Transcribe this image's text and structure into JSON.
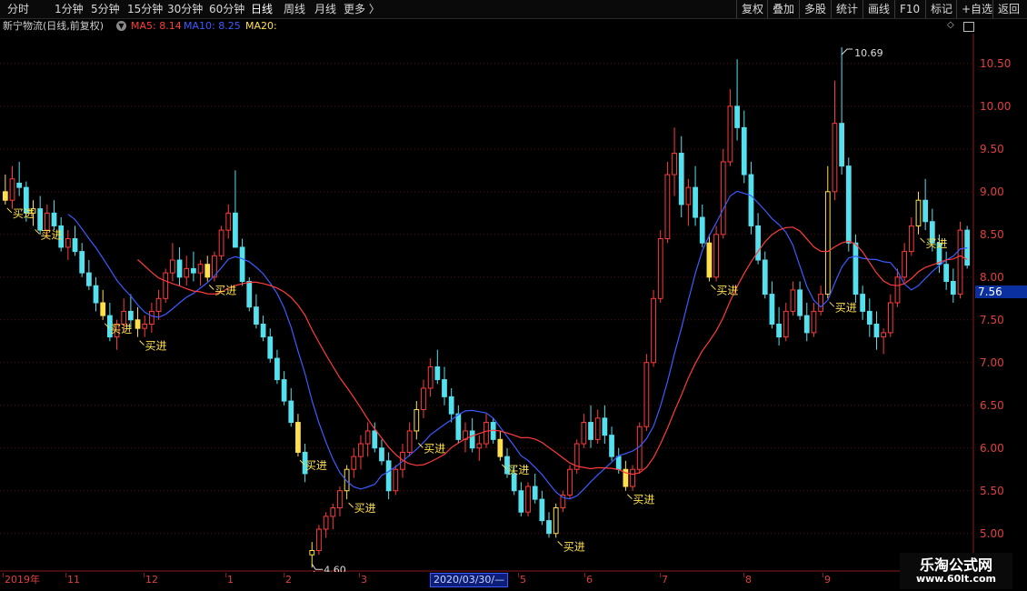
{
  "toolbar": {
    "left": [
      "分时",
      "1分钟",
      "5分钟",
      "15分钟",
      "30分钟",
      "60分钟",
      "日线",
      "周线",
      "月线",
      "更多 〉"
    ],
    "active": "日线",
    "right": [
      "复权",
      "叠加",
      "多股",
      "统计",
      "画线",
      "F10",
      "标记",
      "+自选",
      "返回"
    ]
  },
  "info": {
    "stock": "新宁物流(日线,前复权)",
    "ma5": "MA5: 8.14",
    "ma10": "MA10: 8.25",
    "ma20": "MA20:",
    "ma5_color": "#ff3b3b",
    "ma10_color": "#3c5bff",
    "ma20_color": "#ffe04b"
  },
  "price_axis": {
    "ticks": [
      "10.50",
      "10.00",
      "9.50",
      "9.00",
      "8.50",
      "8.00",
      "7.50",
      "7.00",
      "6.50",
      "6.00",
      "5.50",
      "5.00"
    ],
    "current": "7.56"
  },
  "date_axis": {
    "labels": [
      "2019年",
      "11",
      "12",
      "1",
      "2",
      "3",
      "4",
      "5",
      "6",
      "7",
      "8",
      "9"
    ],
    "cursor": "2020/03/30/—"
  },
  "watermark": {
    "title": "乐淘公式网",
    "url": "www.60lt.com"
  },
  "chart_data": {
    "type": "candlestick",
    "ylim": [
      4.55,
      10.85
    ],
    "up_color": "#ff3b3b",
    "down_color": "#55e0ee",
    "signal_color": "#ffe04b",
    "high_annotation": "10.69",
    "low_annotation": "4.60",
    "signal_label": "买进",
    "candles_ohlc": [
      [
        9.0,
        9.2,
        8.85,
        8.9
      ],
      [
        8.9,
        9.3,
        8.8,
        9.15
      ],
      [
        9.1,
        9.35,
        8.95,
        9.05
      ],
      [
        9.05,
        9.12,
        8.65,
        8.75
      ],
      [
        8.75,
        8.9,
        8.6,
        8.8
      ],
      [
        8.8,
        8.95,
        8.5,
        8.55
      ],
      [
        8.55,
        8.85,
        8.45,
        8.75
      ],
      [
        8.75,
        8.9,
        8.55,
        8.6
      ],
      [
        8.6,
        8.7,
        8.3,
        8.35
      ],
      [
        8.35,
        8.55,
        8.2,
        8.45
      ],
      [
        8.45,
        8.6,
        8.25,
        8.3
      ],
      [
        8.3,
        8.4,
        8.0,
        8.05
      ],
      [
        8.05,
        8.2,
        7.85,
        7.9
      ],
      [
        7.9,
        8.0,
        7.6,
        7.7
      ],
      [
        7.7,
        7.85,
        7.5,
        7.55
      ],
      [
        7.55,
        7.7,
        7.25,
        7.3
      ],
      [
        7.3,
        7.5,
        7.15,
        7.45
      ],
      [
        7.45,
        7.75,
        7.35,
        7.6
      ],
      [
        7.6,
        7.8,
        7.4,
        7.5
      ],
      [
        7.5,
        7.65,
        7.3,
        7.4
      ],
      [
        7.4,
        7.55,
        7.3,
        7.45
      ],
      [
        7.45,
        7.7,
        7.35,
        7.6
      ],
      [
        7.6,
        7.85,
        7.5,
        7.75
      ],
      [
        7.75,
        8.1,
        7.7,
        8.05
      ],
      [
        8.05,
        8.4,
        7.95,
        8.2
      ],
      [
        8.2,
        8.35,
        7.9,
        8.0
      ],
      [
        8.0,
        8.25,
        7.9,
        8.1
      ],
      [
        8.1,
        8.3,
        7.95,
        8.05
      ],
      [
        8.05,
        8.2,
        7.9,
        8.15
      ],
      [
        8.15,
        8.25,
        7.95,
        8.0
      ],
      [
        8.0,
        8.3,
        7.95,
        8.25
      ],
      [
        8.25,
        8.6,
        8.2,
        8.55
      ],
      [
        8.55,
        8.85,
        8.45,
        8.75
      ],
      [
        8.75,
        9.25,
        8.6,
        8.35
      ],
      [
        8.35,
        8.45,
        7.9,
        7.95
      ],
      [
        7.95,
        8.0,
        7.6,
        7.65
      ],
      [
        7.65,
        7.8,
        7.4,
        7.45
      ],
      [
        7.45,
        7.55,
        7.25,
        7.3
      ],
      [
        7.3,
        7.4,
        7.0,
        7.05
      ],
      [
        7.05,
        7.15,
        6.75,
        6.8
      ],
      [
        6.8,
        6.9,
        6.5,
        6.55
      ],
      [
        6.55,
        6.7,
        6.25,
        6.3
      ],
      [
        6.3,
        6.4,
        5.9,
        5.95
      ],
      [
        5.95,
        6.05,
        5.6,
        5.7
      ],
      [
        4.75,
        4.9,
        4.6,
        4.8
      ],
      [
        4.8,
        5.1,
        4.75,
        5.05
      ],
      [
        5.05,
        5.25,
        4.95,
        5.2
      ],
      [
        5.2,
        5.35,
        5.05,
        5.3
      ],
      [
        5.3,
        5.55,
        5.2,
        5.5
      ],
      [
        5.5,
        5.8,
        5.4,
        5.75
      ],
      [
        5.75,
        6.0,
        5.65,
        5.9
      ],
      [
        5.9,
        6.15,
        5.75,
        6.05
      ],
      [
        6.05,
        6.3,
        5.9,
        6.2
      ],
      [
        6.2,
        6.3,
        5.95,
        6.0
      ],
      [
        6.0,
        6.1,
        5.8,
        5.85
      ],
      [
        5.85,
        5.95,
        5.4,
        5.5
      ],
      [
        5.5,
        5.8,
        5.45,
        5.75
      ],
      [
        5.75,
        6.05,
        5.65,
        5.95
      ],
      [
        5.95,
        6.3,
        5.9,
        6.2
      ],
      [
        6.2,
        6.55,
        6.1,
        6.45
      ],
      [
        6.45,
        6.8,
        6.35,
        6.7
      ],
      [
        6.7,
        7.05,
        6.6,
        6.95
      ],
      [
        6.95,
        7.15,
        6.75,
        6.8
      ],
      [
        6.8,
        6.95,
        6.5,
        6.6
      ],
      [
        6.6,
        6.7,
        6.3,
        6.4
      ],
      [
        6.4,
        6.5,
        6.05,
        6.1
      ],
      [
        6.1,
        6.3,
        5.95,
        6.2
      ],
      [
        6.2,
        6.35,
        5.95,
        6.0
      ],
      [
        6.0,
        6.15,
        5.85,
        6.05
      ],
      [
        6.05,
        6.4,
        6.0,
        6.3
      ],
      [
        6.3,
        6.35,
        6.05,
        6.1
      ],
      [
        6.1,
        6.2,
        5.85,
        5.9
      ],
      [
        5.9,
        6.0,
        5.65,
        5.7
      ],
      [
        5.7,
        5.8,
        5.45,
        5.5
      ],
      [
        5.5,
        5.6,
        5.2,
        5.25
      ],
      [
        5.25,
        5.6,
        5.2,
        5.55
      ],
      [
        5.55,
        5.7,
        5.35,
        5.4
      ],
      [
        5.4,
        5.5,
        5.1,
        5.15
      ],
      [
        5.15,
        5.25,
        4.95,
        5.0
      ],
      [
        5.0,
        5.35,
        4.95,
        5.3
      ],
      [
        5.3,
        5.5,
        5.25,
        5.45
      ],
      [
        5.45,
        5.8,
        5.4,
        5.75
      ],
      [
        5.75,
        6.1,
        5.7,
        6.05
      ],
      [
        6.05,
        6.4,
        6.0,
        6.3
      ],
      [
        6.3,
        6.5,
        6.0,
        6.1
      ],
      [
        6.1,
        6.45,
        6.05,
        6.35
      ],
      [
        6.35,
        6.5,
        6.05,
        6.15
      ],
      [
        6.15,
        6.25,
        5.85,
        5.9
      ],
      [
        5.9,
        6.0,
        5.7,
        5.75
      ],
      [
        5.75,
        5.85,
        5.5,
        5.55
      ],
      [
        5.55,
        5.8,
        5.5,
        5.75
      ],
      [
        5.75,
        6.3,
        5.7,
        6.25
      ],
      [
        6.25,
        7.1,
        6.2,
        7.0
      ],
      [
        7.0,
        7.85,
        6.95,
        7.75
      ],
      [
        7.75,
        8.55,
        7.7,
        8.45
      ],
      [
        8.45,
        9.35,
        8.4,
        9.2
      ],
      [
        9.2,
        9.75,
        8.95,
        9.45
      ],
      [
        9.45,
        9.65,
        8.7,
        8.85
      ],
      [
        8.85,
        9.15,
        8.6,
        9.05
      ],
      [
        9.05,
        9.3,
        8.6,
        8.7
      ],
      [
        8.7,
        8.85,
        8.35,
        8.4
      ],
      [
        8.4,
        8.5,
        7.95,
        8.0
      ],
      [
        8.0,
        8.6,
        7.95,
        8.5
      ],
      [
        8.5,
        9.5,
        8.45,
        9.35
      ],
      [
        9.35,
        10.2,
        9.3,
        10.0
      ],
      [
        10.0,
        10.55,
        9.6,
        9.75
      ],
      [
        9.75,
        9.95,
        9.1,
        9.2
      ],
      [
        9.2,
        9.35,
        8.5,
        8.6
      ],
      [
        8.6,
        8.75,
        8.15,
        8.2
      ],
      [
        8.2,
        8.3,
        7.75,
        7.8
      ],
      [
        7.8,
        7.95,
        7.4,
        7.45
      ],
      [
        7.45,
        7.65,
        7.2,
        7.3
      ],
      [
        7.3,
        7.7,
        7.25,
        7.6
      ],
      [
        7.6,
        7.95,
        7.55,
        7.85
      ],
      [
        7.85,
        7.95,
        7.5,
        7.55
      ],
      [
        7.55,
        7.7,
        7.25,
        7.35
      ],
      [
        7.35,
        7.7,
        7.3,
        7.6
      ],
      [
        7.6,
        7.9,
        7.55,
        7.8
      ],
      [
        7.8,
        9.3,
        7.75,
        9.0
      ],
      [
        9.0,
        10.3,
        8.9,
        9.8
      ],
      [
        9.8,
        10.69,
        9.2,
        9.3
      ],
      [
        9.3,
        9.4,
        8.3,
        8.4
      ],
      [
        8.4,
        8.5,
        7.7,
        7.8
      ],
      [
        7.8,
        7.9,
        7.5,
        7.6
      ],
      [
        7.6,
        7.75,
        7.3,
        7.45
      ],
      [
        7.45,
        7.6,
        7.15,
        7.3
      ],
      [
        7.3,
        7.4,
        7.1,
        7.35
      ],
      [
        7.35,
        7.8,
        7.3,
        7.7
      ],
      [
        7.7,
        8.1,
        7.65,
        8.0
      ],
      [
        8.0,
        8.4,
        7.95,
        8.3
      ],
      [
        8.3,
        8.7,
        8.25,
        8.6
      ],
      [
        8.6,
        9.0,
        8.5,
        8.9
      ],
      [
        8.9,
        9.15,
        8.55,
        8.65
      ],
      [
        8.65,
        8.8,
        8.3,
        8.4
      ],
      [
        8.4,
        8.5,
        8.05,
        8.15
      ],
      [
        8.15,
        8.3,
        7.85,
        7.95
      ],
      [
        7.95,
        8.1,
        7.7,
        7.8
      ],
      [
        7.8,
        8.65,
        7.75,
        8.55
      ],
      [
        8.55,
        8.6,
        8.1,
        8.14
      ]
    ],
    "buy_signal_indices": [
      0,
      4,
      14,
      19,
      29,
      42,
      44,
      49,
      59,
      71,
      79,
      89,
      101,
      118,
      131
    ]
  }
}
